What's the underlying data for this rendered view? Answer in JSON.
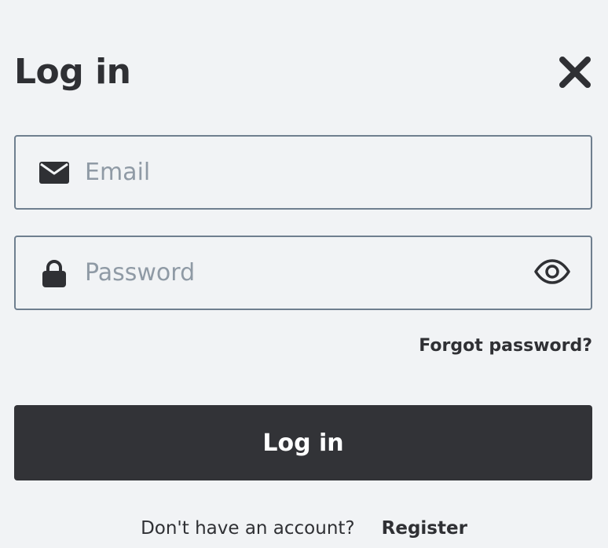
{
  "header": {
    "title": "Log in",
    "close_icon": "close-icon"
  },
  "form": {
    "email": {
      "placeholder": "Email",
      "value": "",
      "icon": "envelope-icon"
    },
    "password": {
      "placeholder": "Password",
      "value": "",
      "icon": "lock-icon",
      "toggle_icon": "eye-icon"
    },
    "forgot_password_label": "Forgot password?",
    "submit_label": "Log in"
  },
  "footer": {
    "prompt": "Don't have an account?",
    "register_label": "Register"
  },
  "colors": {
    "background": "#f1f3f5",
    "text": "#2f3034",
    "placeholder": "#8f9aa5",
    "field_border": "#6f7f8f",
    "button_bg": "#323337",
    "button_text": "#ffffff"
  }
}
